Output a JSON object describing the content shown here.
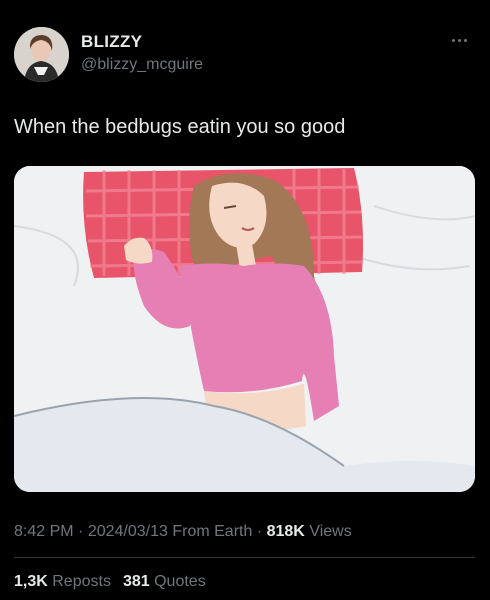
{
  "author": {
    "display_name": "BLIZZY",
    "handle": "@blizzy_mcguire"
  },
  "tweet": {
    "text": "When the bedbugs eatin you so good"
  },
  "meta": {
    "time": "8:42 PM",
    "sep1": "·",
    "date": "2024/03/13",
    "source": "From Earth",
    "sep2": "·",
    "views_count": "818K",
    "views_label": "Views"
  },
  "stats": {
    "reposts_count": "1,3K",
    "reposts_label": "Reposts",
    "quotes_count": "381",
    "quotes_label": "Quotes"
  },
  "icons": {
    "more": "more-horizontal-icon"
  },
  "colors": {
    "background": "#000000",
    "primary_text": "#e7e9ea",
    "secondary_text": "#71767b",
    "pillow": "#e8546a",
    "shirt": "#e57fb4"
  }
}
